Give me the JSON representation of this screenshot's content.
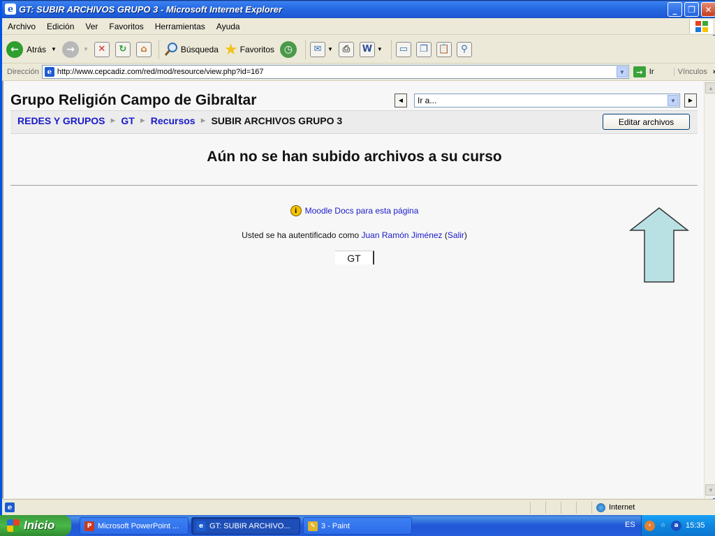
{
  "window": {
    "title": "GT: SUBIR ARCHIVOS GRUPO 3 - Microsoft Internet Explorer",
    "controls": {
      "minimize": "_",
      "maximize": "❐",
      "close": "✕"
    }
  },
  "menu": [
    "Archivo",
    "Edición",
    "Ver",
    "Favoritos",
    "Herramientas",
    "Ayuda"
  ],
  "toolbar": {
    "back_label": "Atrás",
    "search_label": "Búsqueda",
    "favorites_label": "Favoritos"
  },
  "address": {
    "label": "Dirección",
    "url": "http://www.cepcadiz.com/red/mod/resource/view.php?id=167",
    "go_label": "Ir",
    "links_label": "Vínculos"
  },
  "page": {
    "site_title": "Grupo Religión Campo de Gibraltar",
    "jump_placeholder": "Ir a...",
    "breadcrumb": {
      "items": [
        "REDES Y GRUPOS",
        "GT",
        "Recursos"
      ],
      "current": "SUBIR ARCHIVOS GRUPO 3",
      "separator": "►"
    },
    "edit_button": "Editar archivos",
    "message": "Aún no se han subido archivos a su curso",
    "docs_link": "Moodle Docs para esta página",
    "login": {
      "prefix": "Usted se ha autentificado como ",
      "user": "Juan Ramón Jiménez",
      "open": " (",
      "logout": "Salir",
      "close": ")"
    },
    "course_short": "GT",
    "annotation_arrow_color": "#B9E1E4"
  },
  "status": {
    "zone": "Internet"
  },
  "taskbar": {
    "start_label": "Inicio",
    "tasks": [
      {
        "label": "Microsoft PowerPoint ...",
        "icon": "powerpoint-icon",
        "color": "#C8381E"
      },
      {
        "label": "GT: SUBIR ARCHIVO...",
        "icon": "internet-explorer-icon",
        "color": "#1E5CCF"
      },
      {
        "label": "3 - Paint",
        "icon": "paint-icon",
        "color": "#E0B62B"
      }
    ],
    "language": "ES",
    "clock": "15:35"
  }
}
